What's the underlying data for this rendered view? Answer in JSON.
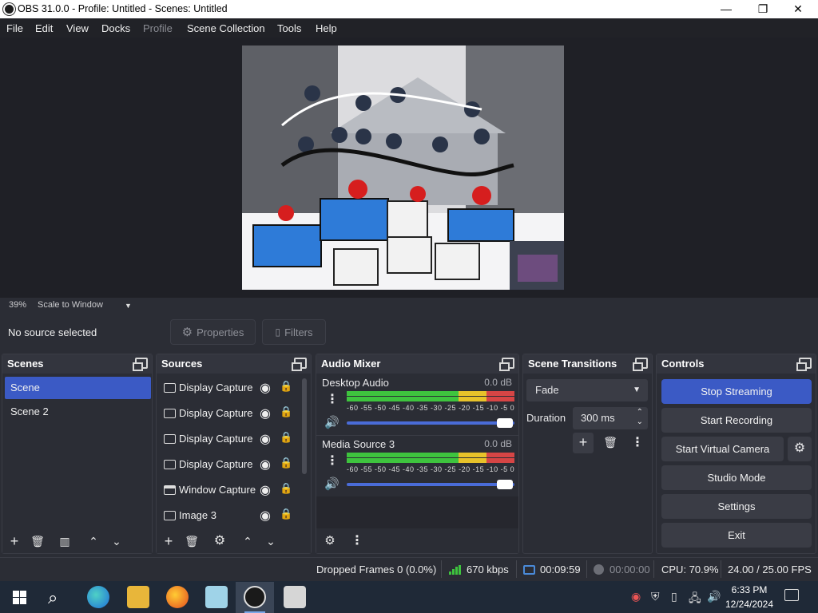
{
  "window": {
    "title": "OBS 31.0.0 - Profile: Untitled - Scenes: Untitled",
    "minimize": "—",
    "maximize": "❐",
    "close": "✕"
  },
  "menu": [
    "File",
    "Edit",
    "View",
    "Docks",
    "Profile",
    "Scene Collection",
    "Tools",
    "Help"
  ],
  "preview": {
    "zoom": "39%",
    "mode": "Scale to Window"
  },
  "context_bar": {
    "no_source": "No source selected",
    "properties": "Properties",
    "filters": "Filters"
  },
  "scenes": {
    "title": "Scenes",
    "items": [
      "Scene",
      "Scene 2"
    ]
  },
  "sources": {
    "title": "Sources",
    "items": [
      "Display Capture",
      "Display Capture",
      "Display Capture",
      "Display Capture",
      "Window Capture",
      "Image 3"
    ]
  },
  "audio_mixer": {
    "title": "Audio Mixer",
    "channels": [
      {
        "name": "Desktop Audio",
        "db": "0.0 dB",
        "volume": 1.0
      },
      {
        "name": "Media Source 3",
        "db": "0.0 dB",
        "volume": 1.0
      }
    ],
    "scale": "-60 -55 -50 -45 -40 -35 -30 -25 -20 -15 -10 -5 0"
  },
  "transitions": {
    "title": "Scene Transitions",
    "selected": "Fade",
    "duration_label": "Duration",
    "duration_value": "300 ms"
  },
  "controls": {
    "title": "Controls",
    "buttons": [
      "Stop Streaming",
      "Start Recording",
      "Start Virtual Camera",
      "Studio Mode",
      "Settings",
      "Exit"
    ]
  },
  "status": {
    "dropped_frames": "Dropped Frames 0 (0.0%)",
    "bitrate": "670 kbps",
    "stream_time": "00:09:59",
    "record_time": "00:00:00",
    "cpu": "CPU: 70.9%",
    "fps": "24.00 / 25.00 FPS"
  },
  "clock": {
    "time": "6:33 PM",
    "date": "12/24/2024"
  },
  "colors": {
    "accent": "#3b5ac5",
    "meter_green": "#3ec43e",
    "meter_yellow": "#e7c22a",
    "meter_red": "#d64545"
  }
}
